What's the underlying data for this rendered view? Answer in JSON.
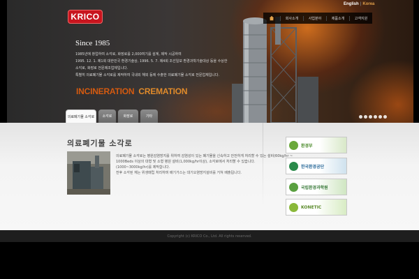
{
  "header": {
    "logo": "KRICO",
    "lang": {
      "english": "English",
      "separator": "|",
      "korea": "Korea"
    },
    "nav": [
      "회사소개",
      "사업분야",
      "제품소개",
      "고객지원"
    ]
  },
  "hero": {
    "since": "Since 1985",
    "intro": [
      "1985년에 창업하여 소각로, 화장로를 2,000여기를 설계, 제작 시공하여",
      "1995. 12. 1. 제1회 대한민국 환경기술상, 1996. 5. 7. 제4회 조선일보 환경과학기술대상 등을 수상한",
      "소각로, 화장로 전문제조업체입니다.",
      "특별히 의료폐기물 소각로를 제작하여 국내외 해외 등에 수출한 의료폐기물 소각로 전문업체입니다."
    ],
    "slogan": {
      "word1": "INCINERATION",
      "word2": "CREMATION"
    }
  },
  "tabs": [
    "의료폐기물 소각로",
    "소각로",
    "화장로",
    "기타"
  ],
  "section": {
    "title": "의료폐기물 소각로",
    "description": [
      "의료폐기물 소각로는 병원감염방지를 위하여 감염성이 있는 폐기물을 신속하고 안전하게 처리할 수 있는 설비(60kg/hr ~",
      "1000Beds 이상의 대형 및 소형 병원 설비(1,000kg/hr이상), 소각로에서 처리할 수 있습니다.",
      "(1000~3000kg/hr)를 제작합니다.",
      "전후 소각된 재는 위생매립 처리하며 배기가스는 대기오염방지설비를 거쳐 배출됩니다."
    ]
  },
  "side_banners": [
    {
      "label": "환경부",
      "color": "#4a8a2a"
    },
    {
      "label": "한국환경공단",
      "color": "#2a6a9a"
    },
    {
      "label": "국립환경과학원",
      "color": "#3a7a3a"
    },
    {
      "label": "KONETIC",
      "color": "#5a8a2a"
    }
  ],
  "footer": {
    "copyright": "Copyright (c) KRICO Co., Ltd. All rights reserved."
  },
  "colors": {
    "brand_red": "#c8141e",
    "accent_orange": "#d45a10",
    "footer_bg": "#1e1e1e"
  }
}
